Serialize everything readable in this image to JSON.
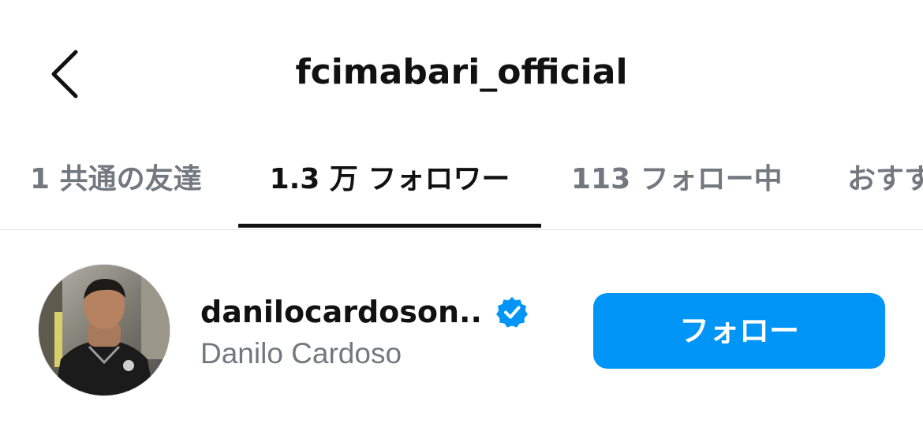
{
  "header": {
    "back_icon": "chevron-left-icon",
    "title": "fcimabari_official"
  },
  "tabs": [
    {
      "label": "1 共通の友達",
      "active": false
    },
    {
      "label": "1.3 万 フォロワー",
      "active": true
    },
    {
      "label": "113 フォロー中",
      "active": false
    },
    {
      "label": "おすす",
      "active": false
    }
  ],
  "list": {
    "items": [
      {
        "username": "danilocardoson...",
        "full_name": "Danilo Cardoso",
        "verified": true,
        "verified_icon": "verified-badge-icon",
        "button_label": "フォロー"
      }
    ]
  },
  "colors": {
    "accent": "#0095f6",
    "verified": "#0095f6",
    "muted_text": "#737880",
    "primary_text": "#111111",
    "active_indicator": "#111111"
  }
}
